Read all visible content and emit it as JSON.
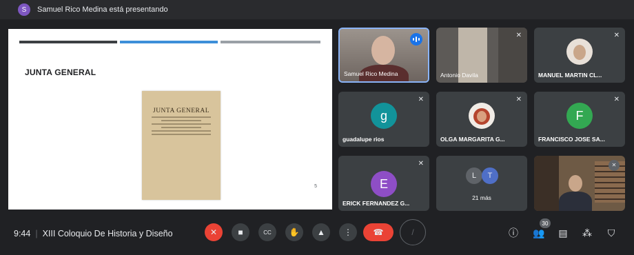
{
  "presenting_banner": {
    "avatar_initial": "S",
    "text": "Samuel Rico Medina está presentando"
  },
  "slide": {
    "title": "JUNTA GENERAL",
    "document_heading": "JUNTA GENERAL",
    "page_number": "5"
  },
  "tiles": [
    {
      "name": "Samuel Rico Medina",
      "kind": "video",
      "speaking": true
    },
    {
      "name": "Antonio Davila",
      "kind": "video",
      "muted": true
    },
    {
      "name": "MANUEL MARTIN CL...",
      "kind": "photo",
      "muted": true
    },
    {
      "name": "guadalupe rios",
      "kind": "initial",
      "initial": "g",
      "color": "#12939a",
      "muted": true
    },
    {
      "name": "OLGA MARGARITA G...",
      "kind": "photo",
      "muted": true
    },
    {
      "name": "FRANCISCO JOSE SA...",
      "kind": "initial",
      "initial": "F",
      "color": "#33a852",
      "muted": true
    },
    {
      "name": "ERICK FERNANDEZ G...",
      "kind": "initial",
      "initial": "E",
      "color": "#8e4ec6",
      "muted": true
    },
    {
      "name": "21 más",
      "kind": "more",
      "avatars": [
        "L",
        "T"
      ],
      "avatar_colors": [
        "#5f6368",
        "#4f6fc7"
      ]
    },
    {
      "name": "",
      "kind": "video",
      "muted": true
    }
  ],
  "bottom_bar": {
    "time": "9:44",
    "meeting_title": "XIII Coloquio De Historia y Diseño",
    "participants_count": "30",
    "controls": [
      "mic-off",
      "camera",
      "captions",
      "raise-hand",
      "present",
      "more-options",
      "end-call",
      "reactions"
    ],
    "side_icons": [
      "info",
      "people",
      "chat",
      "activities",
      "host-controls"
    ]
  },
  "colors": {
    "accent": "#1a73e8",
    "danger": "#ea4335",
    "surface": "#3c4043",
    "background": "#202124"
  }
}
